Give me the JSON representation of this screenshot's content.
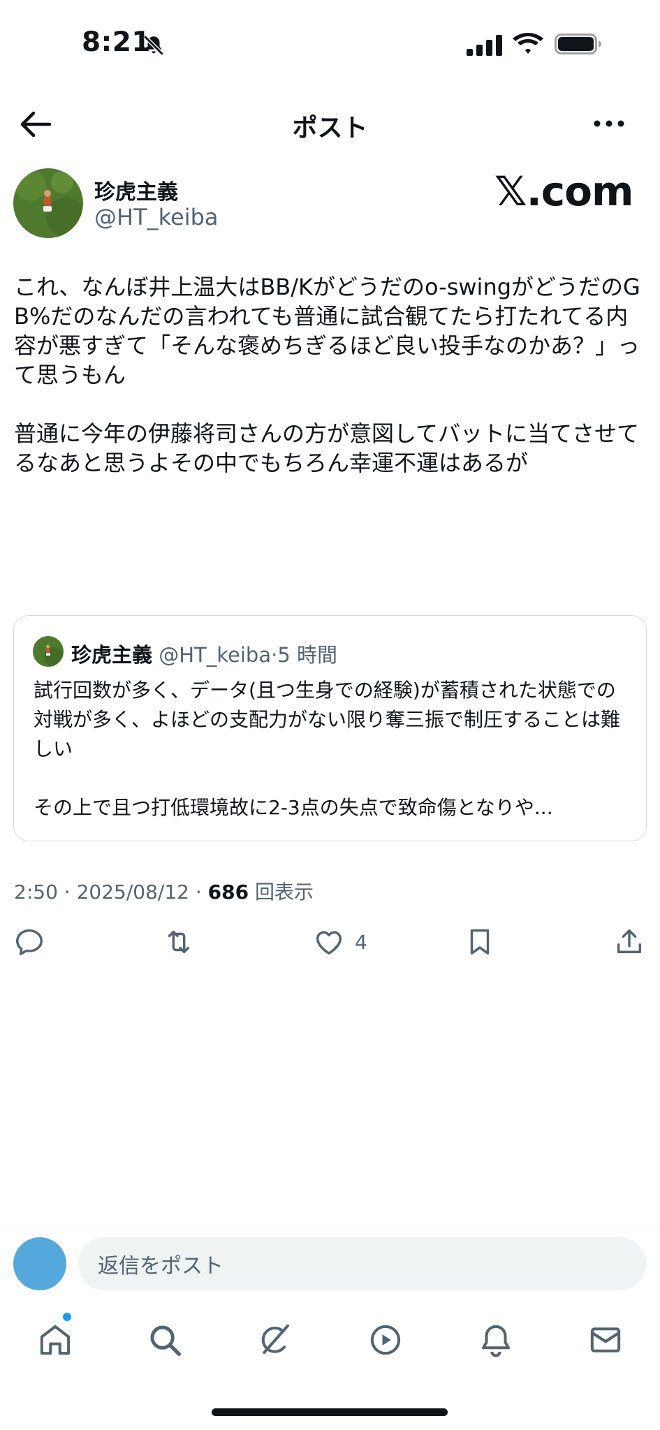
{
  "status_bar": {
    "time": "8:21",
    "icons": [
      "bell-slash-icon",
      "cellular-signal-icon",
      "wifi-icon",
      "battery-icon"
    ]
  },
  "header": {
    "title": "ポスト",
    "back_icon": "arrow-left-icon",
    "more_icon": "more-horizontal-icon"
  },
  "author": {
    "name": "珍虎主義",
    "handle": "@HT_keiba"
  },
  "watermark": "𝕏.com",
  "post": {
    "text": "これ、なんぼ井上温大はBB/Kがどうだのo-swingがどうだのGB%だのなんだの言われても普通に試合観てたら打たれてる内容が悪すぎて「そんな褒めちぎるほど良い投手なのかあ？」って思うもん\n\n普通に今年の伊藤将司さんの方が意図してバットに当てさせてるなあと思うよその中でもちろん幸運不運はあるが"
  },
  "quote": {
    "name": "珍虎主義",
    "handle": "@HT_keiba",
    "separator": "·",
    "time": "5 時間",
    "text": "試行回数が多く、データ(且つ生身での経験)が蓄積された状態での対戦が多く、よほどの支配力がない限り奪三振で制圧することは難しい",
    "text_last": "その上で且つ打低環境故に2-3点の失点で致命傷となりや..."
  },
  "meta": {
    "timestamp": "2:50 · 2025/08/12 · ",
    "views": "686",
    "views_label": " 回表示"
  },
  "actions": {
    "reply_icon": "reply-icon",
    "repost_icon": "repost-icon",
    "like_icon": "heart-icon",
    "like_count": "4",
    "bookmark_icon": "bookmark-icon",
    "share_icon": "share-icon"
  },
  "reply_bar": {
    "placeholder": "返信をポスト"
  },
  "bottom_nav": {
    "items": [
      "home-icon",
      "search-icon",
      "grok-icon",
      "video-icon",
      "notifications-icon",
      "messages-icon"
    ]
  },
  "colors": {
    "text": "#0f1419",
    "secondary": "#536471",
    "accent": "#1d9bf0",
    "border": "#cfd9de",
    "reply_avatar": "#55a8dc"
  }
}
